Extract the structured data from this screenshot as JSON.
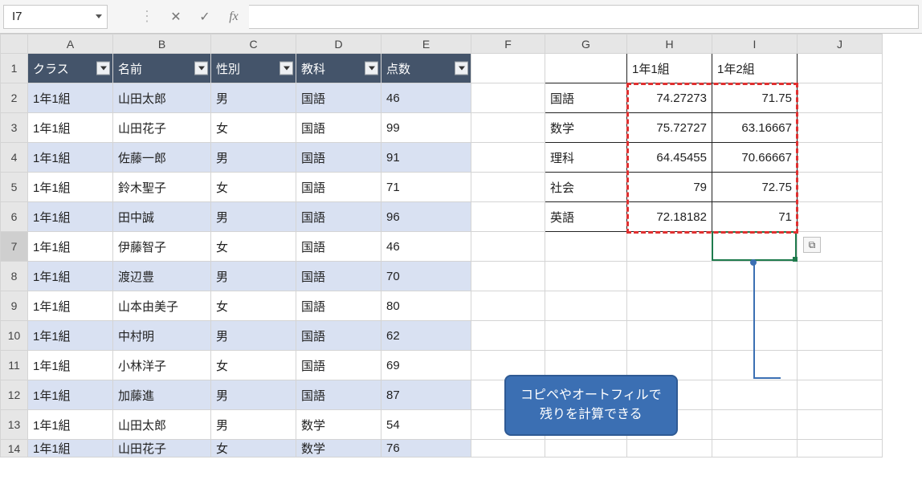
{
  "formulaBar": {
    "cellRef": "I7",
    "fxLabel": "fx",
    "formula": ""
  },
  "columns": [
    "A",
    "B",
    "C",
    "D",
    "E",
    "F",
    "G",
    "H",
    "I",
    "J"
  ],
  "headers": {
    "A": "クラス",
    "B": "名前",
    "C": "性別",
    "D": "教科",
    "E": "点数"
  },
  "rows": [
    {
      "A": "1年1組",
      "B": "山田太郎",
      "C": "男",
      "D": "国語",
      "E": 46
    },
    {
      "A": "1年1組",
      "B": "山田花子",
      "C": "女",
      "D": "国語",
      "E": 99
    },
    {
      "A": "1年1組",
      "B": "佐藤一郎",
      "C": "男",
      "D": "国語",
      "E": 91
    },
    {
      "A": "1年1組",
      "B": "鈴木聖子",
      "C": "女",
      "D": "国語",
      "E": 71
    },
    {
      "A": "1年1組",
      "B": "田中誠",
      "C": "男",
      "D": "国語",
      "E": 96
    },
    {
      "A": "1年1組",
      "B": "伊藤智子",
      "C": "女",
      "D": "国語",
      "E": 46
    },
    {
      "A": "1年1組",
      "B": "渡辺豊",
      "C": "男",
      "D": "国語",
      "E": 70
    },
    {
      "A": "1年1組",
      "B": "山本由美子",
      "C": "女",
      "D": "国語",
      "E": 80
    },
    {
      "A": "1年1組",
      "B": "中村明",
      "C": "男",
      "D": "国語",
      "E": 62
    },
    {
      "A": "1年1組",
      "B": "小林洋子",
      "C": "女",
      "D": "国語",
      "E": 69
    },
    {
      "A": "1年1組",
      "B": "加藤進",
      "C": "男",
      "D": "国語",
      "E": 87
    },
    {
      "A": "1年1組",
      "B": "山田太郎",
      "C": "男",
      "D": "数学",
      "E": 54
    },
    {
      "A": "1年1組",
      "B": "山田花子",
      "C": "女",
      "D": "数学",
      "E": 76
    }
  ],
  "summary": {
    "colHeaders": {
      "H": "1年1組",
      "I": "1年2組"
    },
    "rows": [
      {
        "G": "国語",
        "H": "74.27273",
        "I": "71.75"
      },
      {
        "G": "数学",
        "H": "75.72727",
        "I": "63.16667"
      },
      {
        "G": "理科",
        "H": "64.45455",
        "I": "70.66667"
      },
      {
        "G": "社会",
        "H": "79",
        "I": "72.75"
      },
      {
        "G": "英語",
        "H": "72.18182",
        "I": "71"
      }
    ]
  },
  "callout": {
    "line1": "コピペやオートフィルで",
    "line2": "残りを計算できる"
  },
  "fillCtl": {
    "glyph": "⧉"
  }
}
